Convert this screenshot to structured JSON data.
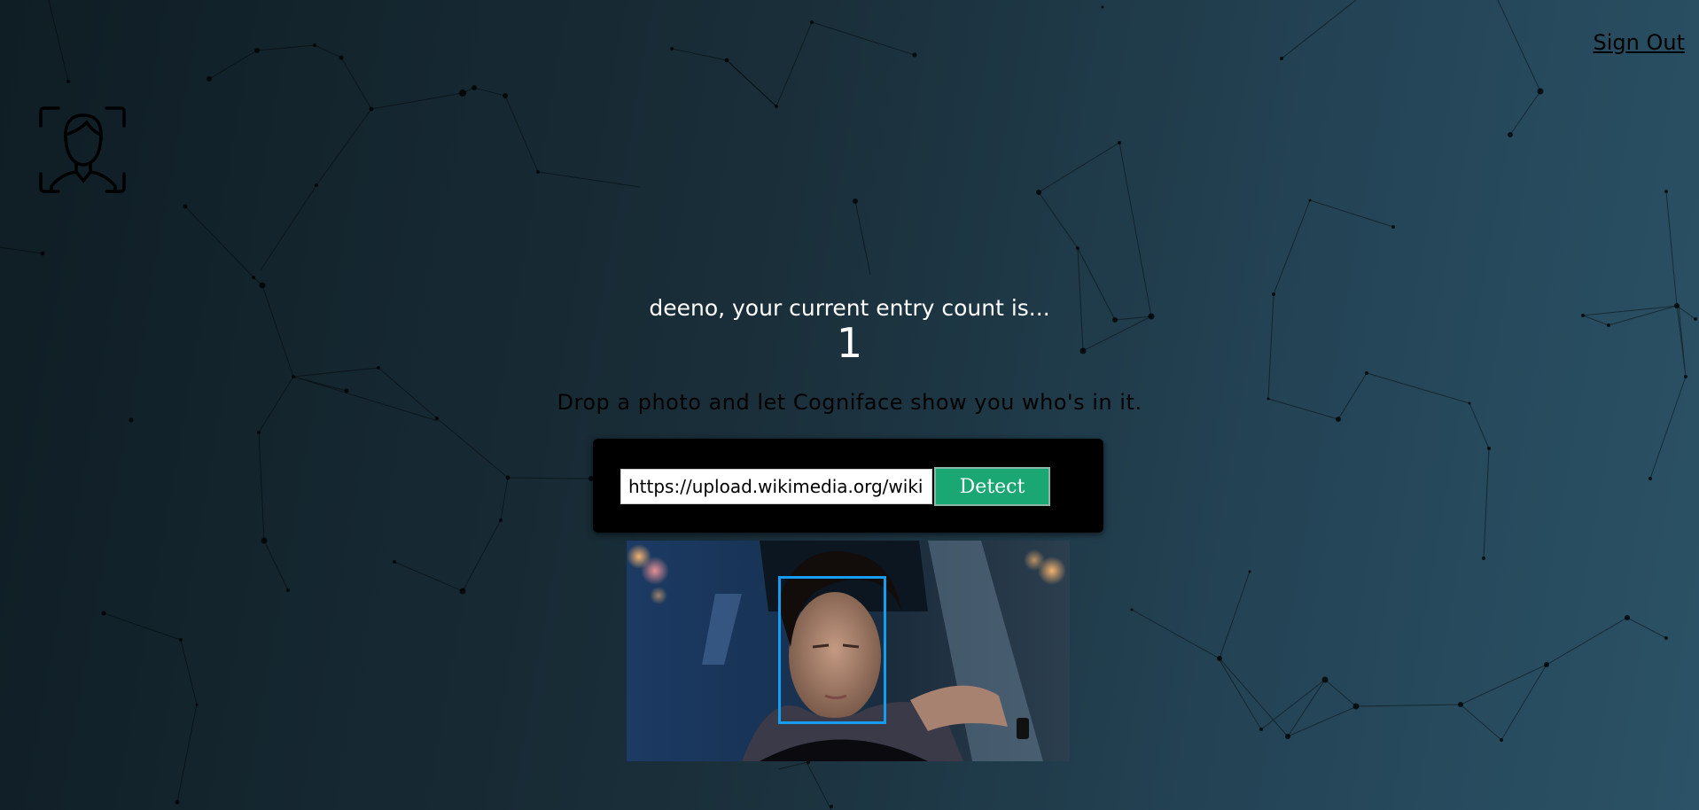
{
  "header": {
    "signout_label": "Sign Out"
  },
  "logo": {
    "icon": "face-scan-icon"
  },
  "rank": {
    "message": "deeno, your current entry count is...",
    "count": "1"
  },
  "instruction": "Drop a photo and let Cogniface show you who's in it.",
  "form": {
    "url_value": "https://upload.wikimedia.org/wiki",
    "detect_label": "Detect"
  },
  "colors": {
    "accent": "#1aa774",
    "face_box": "#149df2"
  }
}
